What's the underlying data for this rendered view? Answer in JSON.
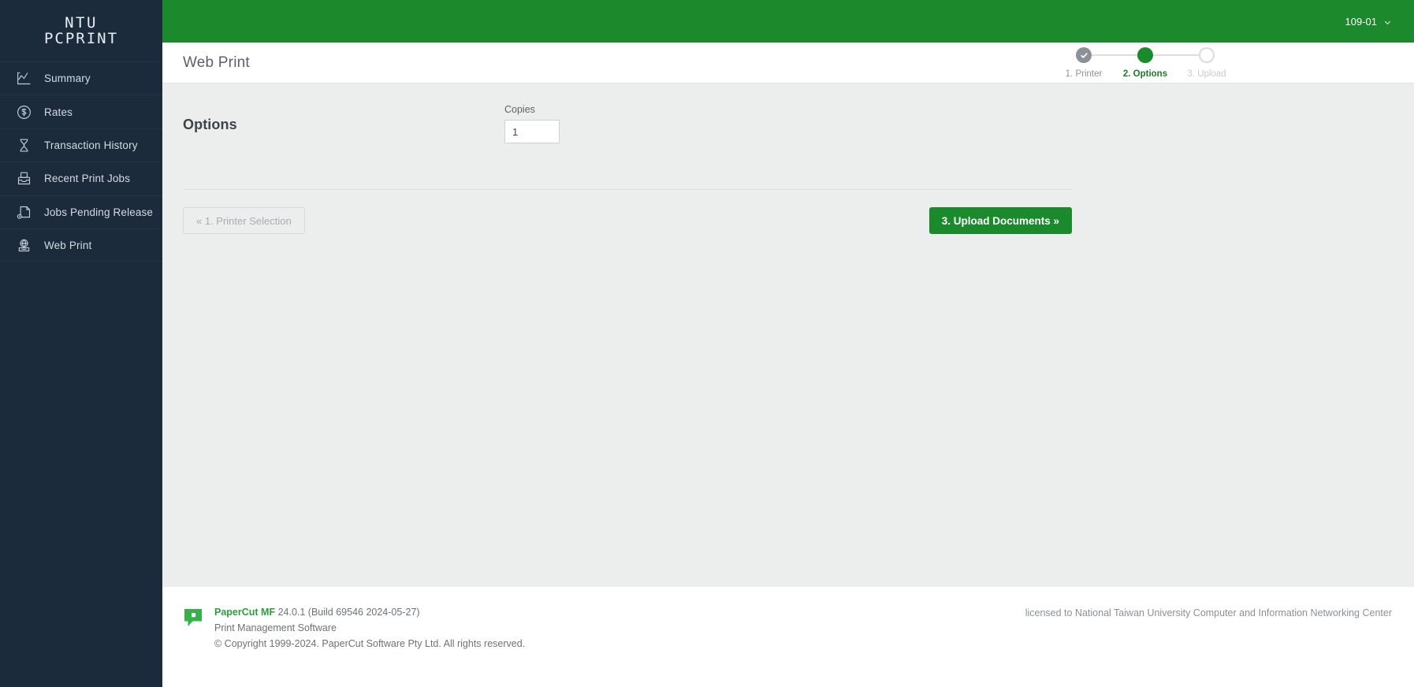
{
  "brand": {
    "logo_line1": "NTU",
    "logo_line2": "PCPRINT",
    "green": "#1b8a2c",
    "sidebar_bg": "#1b2b3b",
    "content_bg": "#eceded"
  },
  "topbar": {
    "user_label": "109-01",
    "caret_icon": "chevron-down-icon"
  },
  "sidebar": {
    "items": [
      {
        "label": "Summary",
        "icon": "chart-line-icon"
      },
      {
        "label": "Rates",
        "icon": "dollar-circle-icon"
      },
      {
        "label": "Transaction History",
        "icon": "hourglass-icon"
      },
      {
        "label": "Recent Print Jobs",
        "icon": "printer-tray-icon"
      },
      {
        "label": "Jobs Pending Release",
        "icon": "document-clock-icon"
      },
      {
        "label": "Web Print",
        "icon": "globe-printer-icon"
      }
    ]
  },
  "page": {
    "title": "Web Print"
  },
  "stepper": {
    "steps": [
      {
        "label": "1. Printer",
        "state": "done",
        "icon": "check-icon"
      },
      {
        "label": "2. Options",
        "state": "current",
        "icon": ""
      },
      {
        "label": "3. Upload",
        "state": "todo",
        "icon": ""
      }
    ]
  },
  "options": {
    "heading": "Options",
    "copies_label": "Copies",
    "copies_value": "1",
    "copies_placeholder": "1"
  },
  "actions": {
    "back_label": "« 1. Printer Selection",
    "next_label": "3. Upload Documents »"
  },
  "footer": {
    "product_name": "PaperCut MF",
    "version": " 24.0.1 (Build 69546 2024-05-27)",
    "tagline": "Print Management Software",
    "copyright": "© Copyright 1999-2024. PaperCut Software Pty Ltd. All rights reserved.",
    "license": "licensed to National Taiwan University Computer and Information Networking Center",
    "logo_icon": "papercut-bubble-icon"
  }
}
